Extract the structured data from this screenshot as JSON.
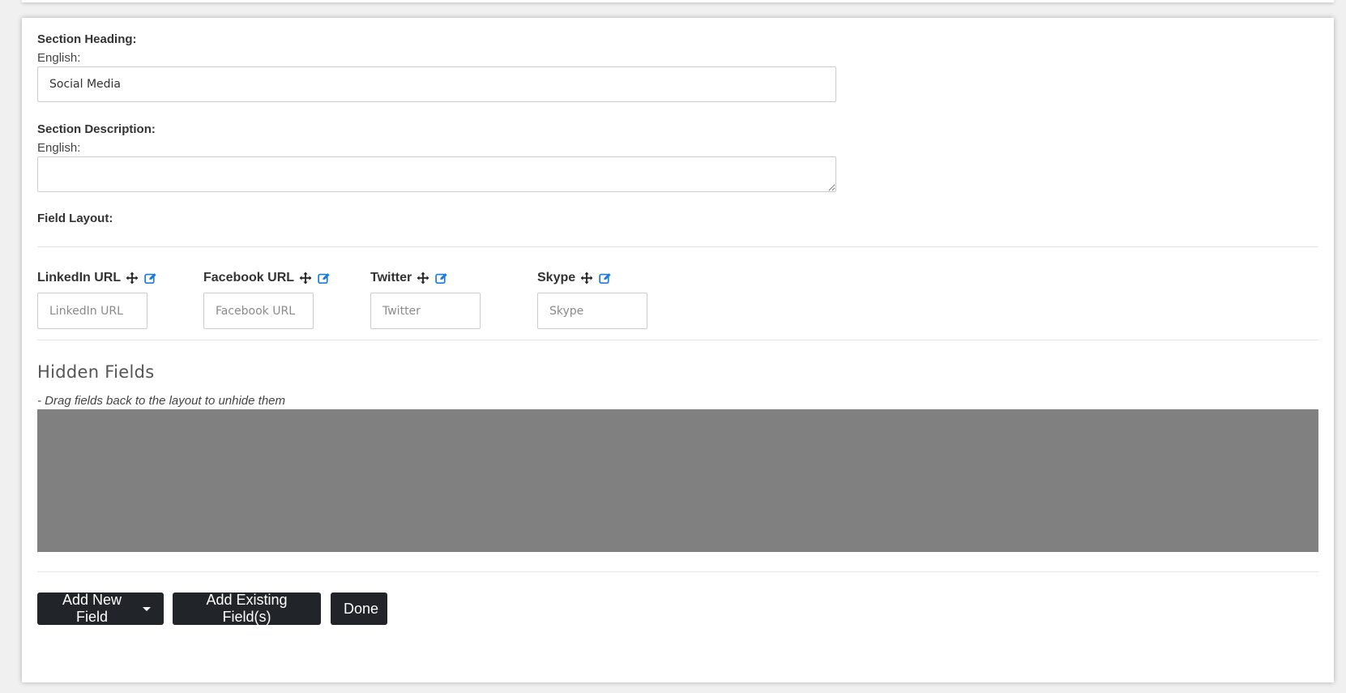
{
  "section_heading": {
    "label": "Section Heading:",
    "language": "English:",
    "value": "Social Media"
  },
  "section_description": {
    "label": "Section Description:",
    "language": "English:",
    "value": ""
  },
  "field_layout": {
    "label": "Field Layout:",
    "fields": [
      {
        "label": "LinkedIn URL",
        "placeholder": "LinkedIn URL",
        "move_icon": "move-icon",
        "edit_icon": "edit-icon"
      },
      {
        "label": "Facebook URL",
        "placeholder": "Facebook URL",
        "move_icon": "move-icon",
        "edit_icon": "edit-icon"
      },
      {
        "label": "Twitter",
        "placeholder": "Twitter",
        "move_icon": "move-icon",
        "edit_icon": "edit-icon"
      },
      {
        "label": "Skype",
        "placeholder": "Skype",
        "move_icon": "move-icon",
        "edit_icon": "edit-icon"
      }
    ]
  },
  "hidden_fields": {
    "title": "Hidden Fields",
    "hint": "- Drag fields back to the layout to unhide them"
  },
  "buttons": {
    "add_new_field": "Add New Field",
    "add_existing_fields": "Add Existing Field(s)",
    "done": "Done"
  },
  "colors": {
    "button_bg": "#212529",
    "edit_icon": "#1e7ae0",
    "drop_zone": "#808080"
  }
}
